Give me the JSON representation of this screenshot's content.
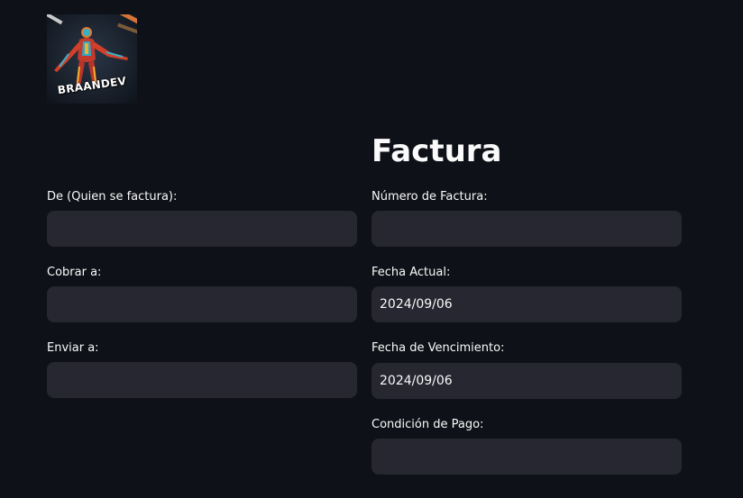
{
  "logo": {
    "text": "BRAANDEV"
  },
  "title": "Factura",
  "left_column": {
    "from_label": "De (Quien se factura):",
    "from_value": "",
    "bill_to_label": "Cobrar a:",
    "bill_to_value": "",
    "ship_to_label": "Enviar a:",
    "ship_to_value": ""
  },
  "right_column": {
    "invoice_number_label": "Número de Factura:",
    "invoice_number_value": "",
    "current_date_label": "Fecha Actual:",
    "current_date_value": "2024/09/06",
    "due_date_label": "Fecha de Vencimiento:",
    "due_date_value": "2024/09/06",
    "payment_terms_label": "Condición de Pago:",
    "payment_terms_value": ""
  },
  "colors": {
    "background": "#0e1117",
    "input_background": "#262730",
    "text": "#fafafa"
  }
}
